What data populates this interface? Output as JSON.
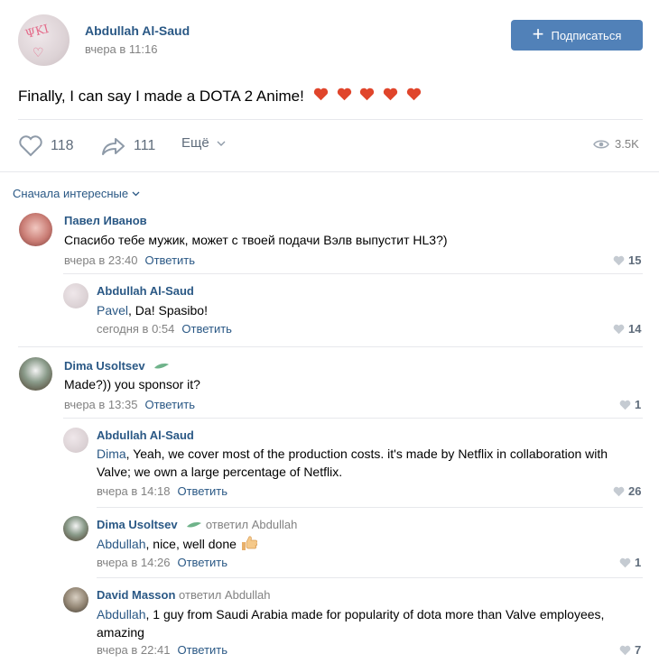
{
  "post": {
    "author": "Abdullah Al-Saud",
    "time": "вчера в 11:16",
    "subscribe_label": "Подписаться",
    "text": "Finally, I can say I made a DOTA 2 Anime!",
    "likes": "118",
    "shares": "111",
    "more_label": "Ещё",
    "views": "3.5K"
  },
  "comments_sort": "Сначала интересные",
  "comments": [
    {
      "name": "Павел Иванов",
      "text": "Спасибо тебе мужик, может с твоей подачи Вэлв выпустит HL3?)",
      "time": "вчера в 23:40",
      "reply_label": "Ответить",
      "likes": "15"
    },
    {
      "name": "Abdullah Al-Saud",
      "mention": "Pavel",
      "text": ", Da! Spasibo!",
      "time": "сегодня в 0:54",
      "reply_label": "Ответить",
      "likes": "14"
    },
    {
      "name": "Dima Usoltsev",
      "text": "Made?)) you sponsor it?",
      "time": "вчера в 13:35",
      "reply_label": "Ответить",
      "likes": "1"
    },
    {
      "name": "Abdullah Al-Saud",
      "mention": "Dima",
      "text_line1": ", Yeah, we cover most of the production costs. it's made by Netflix in collaboration with",
      "text_line2": "Valve; we own a large percentage of Netflix.",
      "time": "вчера в 14:18",
      "reply_label": "Ответить",
      "likes": "26"
    },
    {
      "name": "Dima Usoltsev",
      "replied": "ответил Abdullah",
      "mention": "Abdullah",
      "text": ", nice, well done",
      "time": "вчера в 14:26",
      "reply_label": "Ответить",
      "likes": "1"
    },
    {
      "name": "David Masson",
      "replied": "ответил Abdullah",
      "mention": "Abdullah",
      "text_line1": ", 1 guy from Saudi Arabia made for popularity of dota more than Valve employees,",
      "text_line2": "amazing",
      "time": "вчера в 22:41",
      "reply_label": "Ответить",
      "likes": "7"
    }
  ],
  "colors": {
    "accent": "#2a5885",
    "button": "#5181b8",
    "heart": "#e0452b"
  }
}
